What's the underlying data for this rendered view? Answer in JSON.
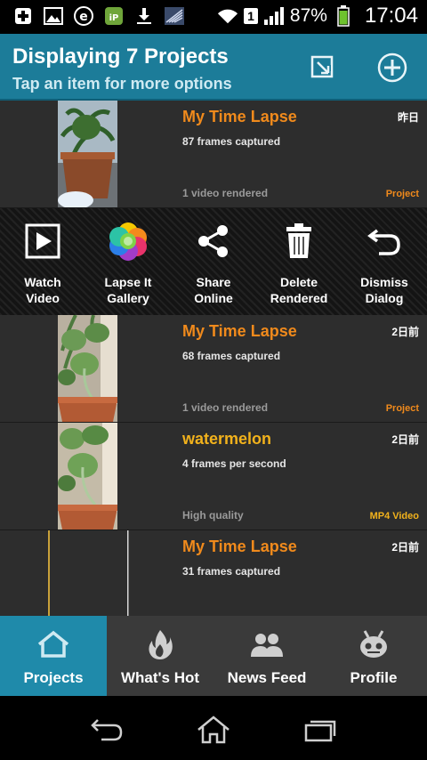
{
  "status_bar": {
    "battery_percent": "87%",
    "sim_slot": "1",
    "time": "17:04",
    "icons": [
      "plus-icon",
      "image-icon",
      "e-icon",
      "ip-icon",
      "download-icon",
      "signal-app-icon",
      "wifi-icon",
      "cell-signal-icon",
      "battery-icon"
    ]
  },
  "action_bar": {
    "title": "Displaying 7 Projects",
    "subtitle": "Tap an item for more options",
    "import_icon": "import-icon",
    "add_icon": "add-circle-icon"
  },
  "projects": [
    {
      "title": "My Time Lapse",
      "subtitle": "87 frames captured",
      "info": "1 video rendered",
      "time": "昨日",
      "type": "Project"
    },
    {
      "title": "My Time Lapse",
      "subtitle": "68 frames captured",
      "info": "1 video rendered",
      "time": "2日前",
      "type": "Project"
    },
    {
      "title": "watermelon",
      "subtitle": "4 frames per second",
      "info": "High quality",
      "time": "2日前",
      "type": "MP4 Video"
    },
    {
      "title": "My Time Lapse",
      "subtitle": "31 frames captured",
      "info": "",
      "time": "2日前",
      "type": ""
    }
  ],
  "options": [
    {
      "label": "Watch\nVideo",
      "icon": "play-icon"
    },
    {
      "label": "Lapse It\nGallery",
      "icon": "gallery-icon"
    },
    {
      "label": "Share\nOnline",
      "icon": "share-icon"
    },
    {
      "label": "Delete\nRendered",
      "icon": "trash-icon"
    },
    {
      "label": "Dismiss\nDialog",
      "icon": "undo-icon"
    }
  ],
  "tabs": [
    {
      "label": "Projects",
      "icon": "home-icon",
      "active": true
    },
    {
      "label": "What's Hot",
      "icon": "flame-icon",
      "active": false
    },
    {
      "label": "News Feed",
      "icon": "people-icon",
      "active": false
    },
    {
      "label": "Profile",
      "icon": "robot-icon",
      "active": false
    }
  ],
  "nav": [
    "back-icon",
    "home-nav-icon",
    "recents-icon"
  ],
  "colors": {
    "accent": "#1c7c99",
    "tab_active": "#1f8aaa",
    "title_orange": "#f08a1c",
    "title_yellow": "#f2b21c"
  }
}
